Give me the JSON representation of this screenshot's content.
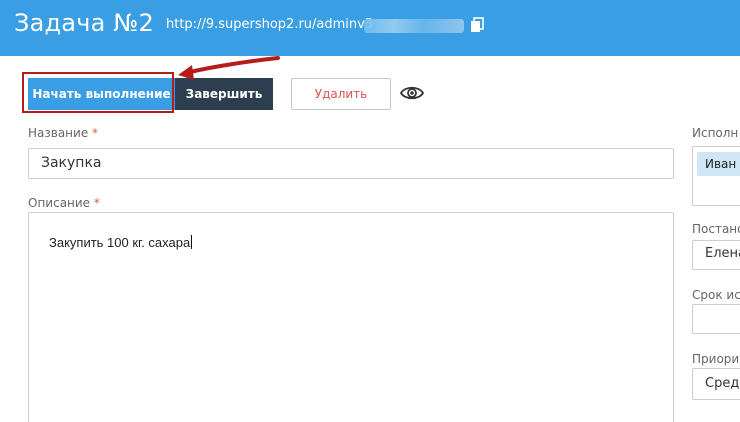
{
  "header": {
    "title": "Задача №2",
    "url": "http://9.supershop2.ru/adminv3"
  },
  "toolbar": {
    "start_label": "Начать выполнение",
    "finish_label": "Завершить",
    "delete_label": "Удалить"
  },
  "form": {
    "name_label": "Название",
    "name_value": "Закупка",
    "description_label": "Описание",
    "description_value": "Закупить 100 кг. сахара",
    "required_mark": "*"
  },
  "sidebar": {
    "assignee_label": "Исполн",
    "assignee_chip": "Иван",
    "creator_label": "Постано",
    "creator_value": "Елена",
    "deadline_label": "Срок ис",
    "priority_label": "Приори",
    "priority_value": "Сред"
  },
  "colors": {
    "header_bg": "#3a9ee4",
    "start_button": "#3a9ee4",
    "finish_button": "#2c3e50",
    "delete_text": "#d9534f",
    "annotation": "#b71c1c",
    "required": "#e0594b"
  },
  "icons": {
    "copy": "copy-icon",
    "visibility": "eye-icon",
    "annotation_arrow": "arrow-annotation"
  }
}
